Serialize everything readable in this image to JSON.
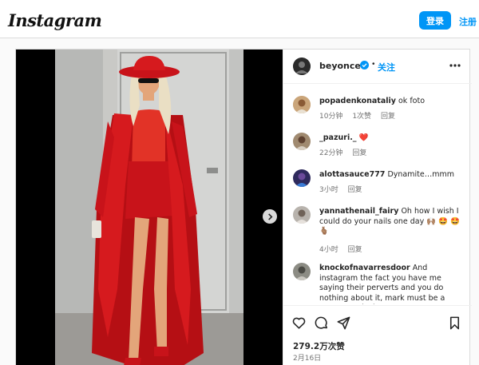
{
  "header": {
    "logo": "Instagram",
    "login_label": "登录",
    "signup_label": "注册"
  },
  "post": {
    "author": "beyonce",
    "follow_label": "关注",
    "likes": "279.2万次赞",
    "date": "2月16日"
  },
  "comments": [
    {
      "user": "popadenkonataliy",
      "text": "ok foto",
      "time": "10分钟",
      "likes": "1次赞",
      "reply": "回复"
    },
    {
      "user": "_pazuri._",
      "text": "❤️",
      "time": "22分钟",
      "reply": "回复"
    },
    {
      "user": "alottasauce777",
      "text": "Dynamite…mmm",
      "time": "3小时",
      "reply": "回复"
    },
    {
      "user": "yannathenail_fairy",
      "text": "Oh how I wish I could do your nails one day 🙌🏽 🤩 🤩 🫰🏽",
      "time": "4小时",
      "reply": "回复"
    },
    {
      "user": "knockofnavarresdoor",
      "text": "And instagram the fact you have me saying their perverts and you do nothing about it, mark must be a pervert typical USA"
    }
  ],
  "colors": {
    "accent": "#0095f6",
    "outfit_red": "#d4161a",
    "verified": "#0095f6"
  }
}
